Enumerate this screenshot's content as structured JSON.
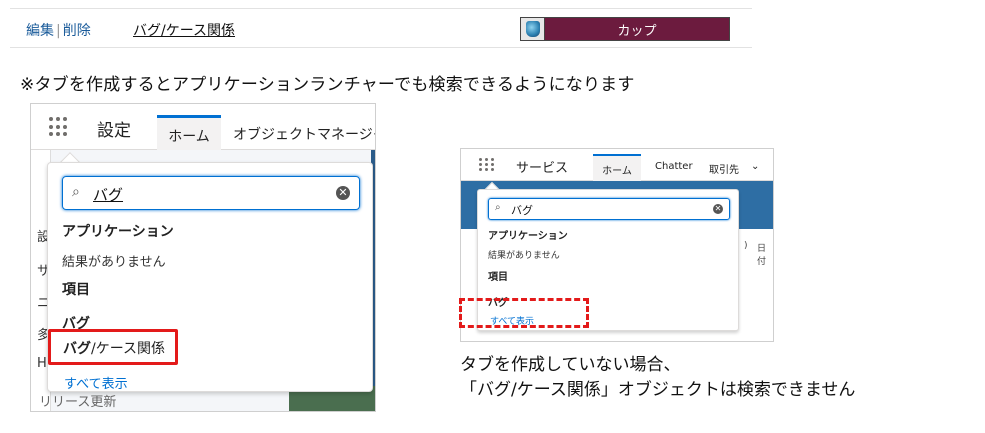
{
  "top_row": {
    "edit_label": "編集",
    "separator": "|",
    "delete_label": "削除",
    "tab_label": "バグ/ケース関係",
    "tab_style_label": "カップ",
    "tab_style_color": "#6c1b3e"
  },
  "note": "※タブを作成するとアプリケーションランチャーでも検索できるようになります",
  "left_shot": {
    "app_name": "設定",
    "tab_home": "ホーム",
    "tab_object_manager": "オブジェクトマネージャ",
    "bg_items": [
      "設",
      "サ",
      "ニ",
      "多",
      "H"
    ],
    "bottom_text": "リリース更新",
    "search_value": "バグ",
    "section_apps": "アプリケーション",
    "no_results": "結果がありません",
    "section_items": "項目",
    "group_bug": "バグ",
    "result_bold": "バグ",
    "result_rest": "/ケース関係",
    "show_all": "すべて表示"
  },
  "right_shot": {
    "app_name": "サービス",
    "tab_home": "ホーム",
    "tab_chatter": "Chatter",
    "tab_accounts": "取引先",
    "bg_text_1": ")",
    "bg_text_2": "日付",
    "search_value": "バグ",
    "section_apps": "アプリケーション",
    "no_results": "結果がありません",
    "section_items": "項目",
    "group_bug": "バグ",
    "show_all": "すべて表示"
  },
  "caption": {
    "line1": "タブを作成していない場合、",
    "line2": "「バグ/ケース関係」オブジェクトは検索できません"
  },
  "colors": {
    "accent_blue": "#0070d2",
    "highlight_red": "#e31a1a"
  }
}
